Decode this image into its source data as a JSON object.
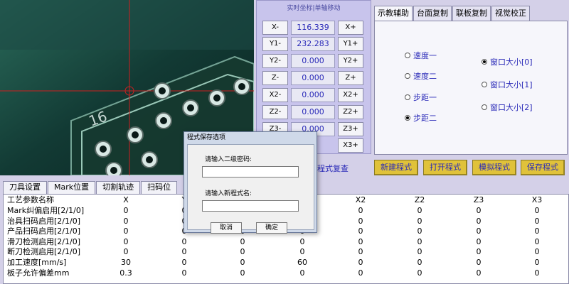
{
  "camera": {
    "silkscreen_label": "16"
  },
  "coordinates": {
    "title": "实时坐标|单轴移动",
    "axes": [
      {
        "minus": "X-",
        "value": "116.339",
        "plus": "X+"
      },
      {
        "minus": "Y1-",
        "value": "232.283",
        "plus": "Y1+"
      },
      {
        "minus": "Y2-",
        "value": "0.000",
        "plus": "Y2+"
      },
      {
        "minus": "Z-",
        "value": "0.000",
        "plus": "Z+"
      },
      {
        "minus": "X2-",
        "value": "0.000",
        "plus": "X2+"
      },
      {
        "minus": "Z2-",
        "value": "0.000",
        "plus": "Z2+"
      },
      {
        "minus": "Z3-",
        "value": "0.000",
        "plus": "Z3+"
      },
      {
        "minus": "",
        "value": "",
        "plus": "X3+"
      }
    ]
  },
  "right_tabs": {
    "tabs": [
      "示教辅助",
      "台面复制",
      "联板复制",
      "视觉校正"
    ],
    "active": "示教辅助",
    "left_radios": [
      {
        "label": "速度一",
        "selected": false
      },
      {
        "label": "速度二",
        "selected": false
      },
      {
        "label": "步距一",
        "selected": false
      },
      {
        "label": "步距二",
        "selected": true
      }
    ],
    "right_radios": [
      {
        "label": "窗口大小[0]",
        "selected": true
      },
      {
        "label": "窗口大小[1]",
        "selected": false
      },
      {
        "label": "窗口大小[2]",
        "selected": false
      }
    ]
  },
  "program": {
    "review_label": "程式复查",
    "buttons": [
      "新建程式",
      "打开程式",
      "模拟程式",
      "保存程式"
    ]
  },
  "bottom_tabs": [
    "刀具设置",
    "Mark位置",
    "切割轨迹",
    "扫码位"
  ],
  "table": {
    "headers": [
      "工艺参数名称",
      "X",
      "Y",
      "",
      "",
      "X2",
      "Z2",
      "Z3",
      "X3"
    ],
    "rows": [
      {
        "name": "Mark纠偏启用[2/1/0]",
        "values": [
          "0",
          "0",
          "",
          "",
          "0",
          "0",
          "0",
          "0"
        ]
      },
      {
        "name": "治具扫码启用[2/1/0]",
        "values": [
          "0",
          "0",
          "",
          "",
          "0",
          "0",
          "0",
          "0"
        ]
      },
      {
        "name": "产品扫码启用[2/1/0]",
        "values": [
          "0",
          "0",
          "0",
          "0",
          "0",
          "0",
          "0",
          "0"
        ]
      },
      {
        "name": "滑刀检测启用[2/1/0]",
        "values": [
          "0",
          "0",
          "0",
          "0",
          "0",
          "0",
          "0",
          "0"
        ]
      },
      {
        "name": "断刀检测启用[2/1/0]",
        "values": [
          "0",
          "0",
          "0",
          "0",
          "0",
          "0",
          "0",
          "0"
        ]
      },
      {
        "name": "加工速度[mm/s]",
        "values": [
          "30",
          "0",
          "0",
          "60",
          "0",
          "0",
          "0",
          "0"
        ]
      },
      {
        "name": "板子允许偏差mm",
        "values": [
          "0.3",
          "0",
          "0",
          "0",
          "0",
          "0",
          "0",
          "0"
        ]
      }
    ]
  },
  "dialog": {
    "title": "程式保存选项",
    "password_label": "请输入二级密码:",
    "name_label": "请输入新程式名:",
    "password_value": "",
    "name_value": "",
    "cancel": "取消",
    "ok": "确定"
  }
}
